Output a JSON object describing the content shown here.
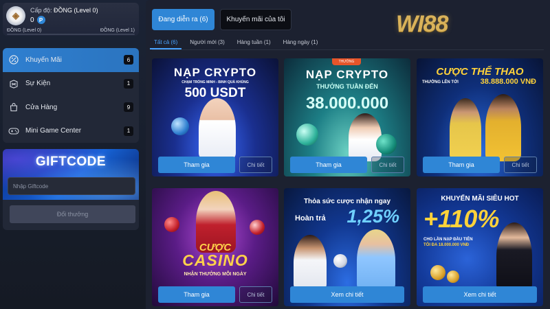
{
  "level": {
    "label": "Cấp độ:",
    "value": "ĐỒNG (Level 0)",
    "points": "0",
    "coin_symbol": "P",
    "from": "ĐỒNG (Level 0)",
    "to": "ĐỒNG (Level 1)",
    "progress_fraction": 0.0
  },
  "sidebar": {
    "items": [
      {
        "label": "Khuyến Mãi",
        "count": "6",
        "icon": "percent-icon",
        "active": true
      },
      {
        "label": "Sự Kiện",
        "count": "1",
        "icon": "event-icon",
        "active": false
      },
      {
        "label": "Cửa Hàng",
        "count": "9",
        "icon": "shop-bag-icon",
        "active": false
      },
      {
        "label": "Mini Game Center",
        "count": "1",
        "icon": "gamepad-icon",
        "active": false
      }
    ]
  },
  "giftcode": {
    "title": "GIFTCODE",
    "placeholder": "Nhập Giftcode",
    "button": "Đổi thưởng"
  },
  "tabs": {
    "active": "Đang diễn ra (6)",
    "other": "Khuyến mãi của tôi"
  },
  "logo": "WI88",
  "subtabs": [
    "Tất cả (6)",
    "Người mới (3)",
    "Hàng tuần (1)",
    "Hàng ngày (1)"
  ],
  "cards": [
    {
      "line1": "NẠP CRYPTO",
      "line2": "CHẠM TRÒNG MINH - BINH QUÀ KHỦNG",
      "line3": "500 USDT",
      "primary": "Tham gia",
      "secondary": "Chi tiết"
    },
    {
      "tag": "THƯỞNG",
      "line1": "NẠP CRYPTO",
      "line2": "THƯỞNG TUẦN ĐẾN",
      "line3": "38.000.000",
      "primary": "Tham gia",
      "secondary": "Chi tiết"
    },
    {
      "line1": "CƯỢC THỂ THAO",
      "line2": "THƯỞNG LÊN TỚI",
      "line3": "38.888.000 VNĐ",
      "primary": "Tham gia",
      "secondary": "Chi tiết"
    },
    {
      "line1": "CƯỢC",
      "line2": "CASINO",
      "line3": "NHẬN THƯỞNG MỖI NGÀY",
      "primary": "Tham gia",
      "secondary": "Chi tiết"
    },
    {
      "line1": "Thỏa sức cược nhận ngay",
      "line2": "Hoàn trả",
      "line3": "1,25%",
      "primary": "Xem chi tiết"
    },
    {
      "line1": "KHUYẾN MÃI SIÊU HOT",
      "line2": "+110%",
      "line3": "CHO LẦN NẠP ĐẦU TIÊN",
      "line4": "TỐI ĐA 18.000.000 VNĐ",
      "primary": "Xem chi tiết"
    }
  ]
}
